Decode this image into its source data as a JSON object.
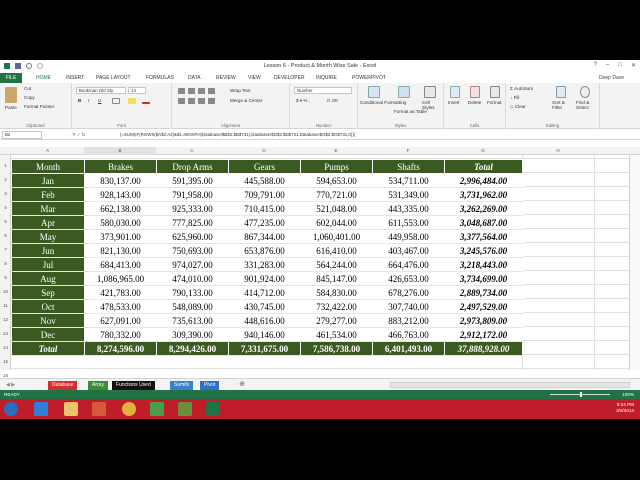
{
  "window": {
    "title": "Lesson 6 - Product & Month Wise Sale - Excel"
  },
  "ribbon": {
    "tabs": [
      "FILE",
      "HOME",
      "INSERT",
      "PAGE LAYOUT",
      "FORMULAS",
      "DATA",
      "REVIEW",
      "VIEW",
      "DEVELOPER",
      "INQUIRE",
      "POWERPIVOT"
    ],
    "user": "Deep Dave",
    "clipboard": {
      "cut": "Cut",
      "copy": "Copy",
      "format_painter": "Format Painter",
      "paste": "Paste",
      "label": "Clipboard"
    },
    "font": {
      "name": "Bookman Old Sty",
      "size": "14",
      "label": "Font"
    },
    "alignment": {
      "wrap": "Wrap Text",
      "merge": "Merge & Center",
      "label": "Alignment"
    },
    "number": {
      "format": "Number",
      "label": "Number"
    },
    "styles": {
      "conditional": "Conditional Formatting",
      "format_table": "Format as Table",
      "cell_styles": "Cell Styles",
      "label": "Styles"
    },
    "cells": {
      "insert": "Insert",
      "delete": "Delete",
      "format": "Format",
      "label": "Cells"
    },
    "editing": {
      "autosum": "AutoSum",
      "fill": "Fill",
      "clear": "Clear",
      "sort": "Sort & Filter",
      "find": "Find & Select",
      "label": "Editing"
    }
  },
  "formula_bar": {
    "name_box": "B2",
    "formula": "{=SUM(IF(ROWS($A$2:A2)&$1=MONTH(Database!$B$2:$B$731),Database!$D$2:$D$731,Database!$G$2:$G$731,0))}"
  },
  "columns": [
    "A",
    "B",
    "C",
    "D",
    "E",
    "F",
    "G",
    "H"
  ],
  "rows": [
    "1",
    "2",
    "3",
    "4",
    "5",
    "6",
    "7",
    "8",
    "9",
    "10",
    "11",
    "12",
    "13",
    "14",
    "15",
    "16"
  ],
  "table": {
    "headers": [
      "Month",
      "Brakes",
      "Drop Arms",
      "Gears",
      "Pumps",
      "Shafts",
      "Total"
    ],
    "rows": [
      [
        "Jan",
        "830,137.00",
        "591,395.00",
        "445,588.00",
        "594,653.00",
        "534,711.00",
        "2,996,484.00"
      ],
      [
        "Feb",
        "928,143.00",
        "791,958.00",
        "709,791.00",
        "770,721.00",
        "531,349.00",
        "3,731,962.00"
      ],
      [
        "Mar",
        "662,138.00",
        "925,333.00",
        "710,415.00",
        "521,048.00",
        "443,335.00",
        "3,262,269.00"
      ],
      [
        "Apr",
        "580,030.00",
        "777,825.00",
        "477,235.00",
        "602,044.00",
        "611,553.00",
        "3,048,687.00"
      ],
      [
        "May",
        "373,901.00",
        "625,960.00",
        "867,344.00",
        "1,060,401.00",
        "449,958.00",
        "3,377,564.00"
      ],
      [
        "Jun",
        "821,130.00",
        "750,693.00",
        "653,876.00",
        "616,410.00",
        "403,467.00",
        "3,245,576.00"
      ],
      [
        "Jul",
        "684,413.00",
        "974,027.00",
        "331,283.00",
        "564,244.00",
        "664,476.00",
        "3,218,443.00"
      ],
      [
        "Aug",
        "1,086,965.00",
        "474,010.00",
        "901,924.00",
        "845,147.00",
        "426,653.00",
        "3,734,699.00"
      ],
      [
        "Sep",
        "421,783.00",
        "790,133.00",
        "414,712.00",
        "584,830.00",
        "678,276.00",
        "2,889,734.00"
      ],
      [
        "Oct",
        "478,533.00",
        "548,089.00",
        "430,745.00",
        "732,422.00",
        "307,740.00",
        "2,497,529.00"
      ],
      [
        "Nov",
        "627,091.00",
        "735,613.00",
        "448,616.00",
        "279,277.00",
        "883,212.00",
        "2,973,809.00"
      ],
      [
        "Dec",
        "780,332.00",
        "309,390.00",
        "940,146.00",
        "461,534.00",
        "466,763.00",
        "2,912,172.00"
      ]
    ],
    "total_row": [
      "Total",
      "8,274,596.00",
      "8,294,426.00",
      "7,331,675.00",
      "7,586,738.00",
      "6,401,493.00",
      "37,888,928.00"
    ]
  },
  "sheet_tabs": [
    {
      "label": "Database",
      "color": "#d32f2f"
    },
    {
      "label": "Array",
      "color": "#3b8c3b"
    },
    {
      "label": "Functions Used",
      "color": "#111111"
    },
    {
      "label": "Sumifs",
      "color": "#3a7fd0"
    },
    {
      "label": "Pivot",
      "color": "#2f6fc9"
    }
  ],
  "status": {
    "ready": "READY",
    "zoom": "100%"
  },
  "clock": {
    "time": "8:24 PM",
    "date": "3/6/2014"
  },
  "colors": {
    "excel_green": "#217346",
    "header_green": "#3b5a22",
    "taskbar": "#c01d2b"
  }
}
